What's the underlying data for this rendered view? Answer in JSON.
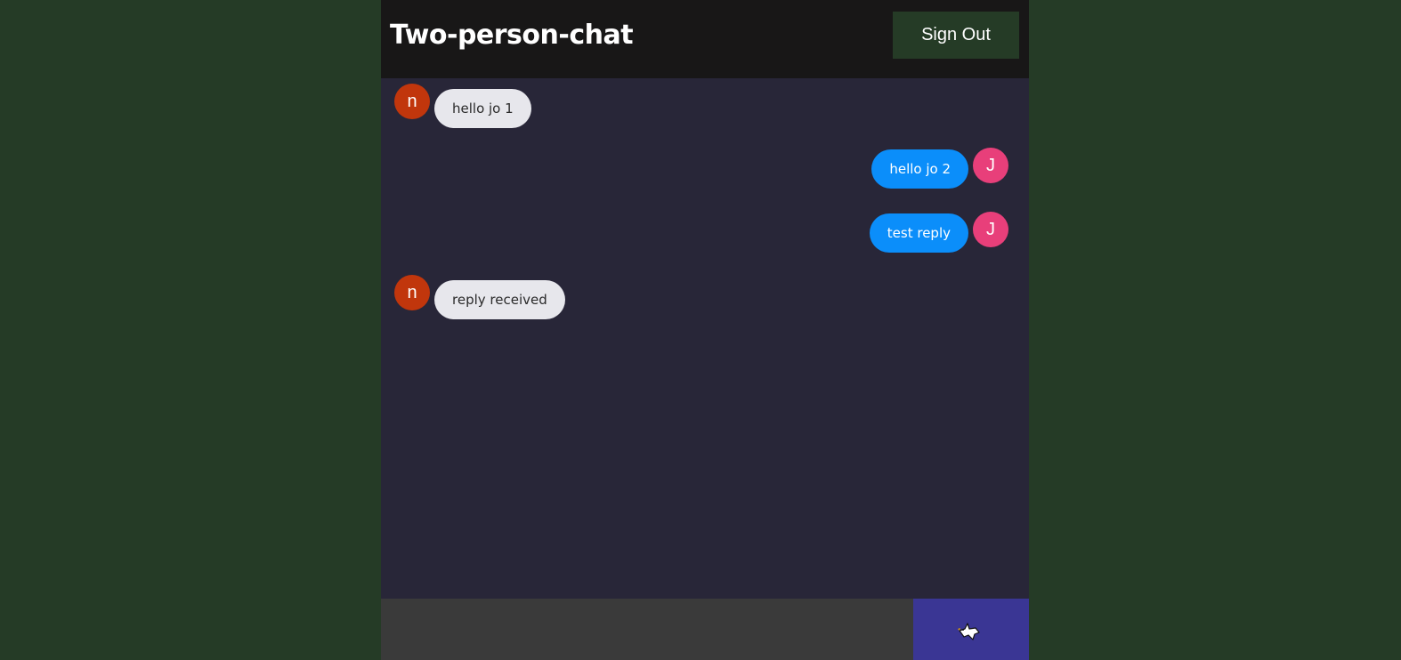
{
  "header": {
    "title": "Two-person-chat",
    "signout_label": "Sign Out"
  },
  "colors": {
    "page_bg": "#253b26",
    "app_bg": "#282638",
    "header_bg": "#181717",
    "signout_bg": "#253b26",
    "received_bubble": "#e7e7ec",
    "sent_bubble": "#0b8efa",
    "received_avatar": "#c1360c",
    "sent_avatar": "#e83f7a",
    "composer_bg": "#3a3a3a",
    "send_button_bg": "#3a3694"
  },
  "messages": [
    {
      "direction": "received",
      "avatar": "n",
      "text": "hello jo 1"
    },
    {
      "direction": "sent",
      "avatar": "J",
      "text": "hello jo 2"
    },
    {
      "direction": "sent",
      "avatar": "J",
      "text": "test reply"
    },
    {
      "direction": "received",
      "avatar": "n",
      "text": "reply received"
    }
  ],
  "composer": {
    "value": "",
    "placeholder": "",
    "send_icon": "dove-icon"
  }
}
